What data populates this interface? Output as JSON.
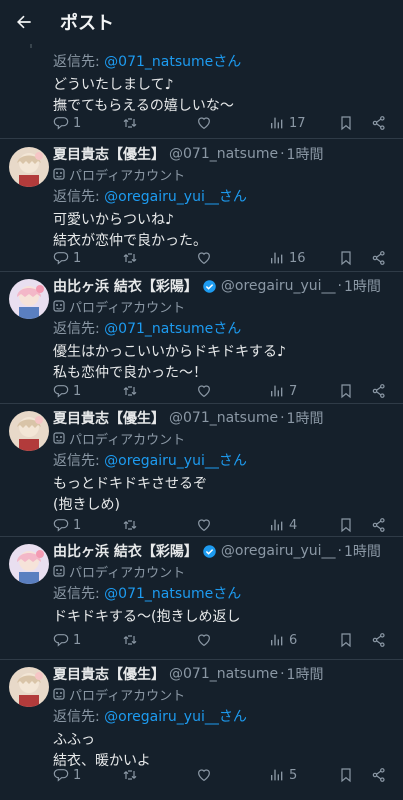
{
  "header": {
    "title": "ポスト"
  },
  "labels": {
    "reply_prefix": "返信先: ",
    "san": "さん"
  },
  "first": {
    "mention": "@071_natsume",
    "text1": "どういたしまして♪",
    "text2": "撫でてもらえるの嬉しいな〜",
    "replies": "1",
    "views": "17"
  },
  "posts": [
    {
      "name": "夏目貴志【優生】",
      "handle": "@071_natsume",
      "time": "1時間",
      "label": "パロディアカウント",
      "mention": "@oregairu_yui__",
      "text1": "可愛いからついね♪",
      "text2": "結衣が恋仲で良かった。",
      "replies": "1",
      "views": "16"
    },
    {
      "name": "由比ヶ浜 結衣【彩陽】",
      "handle": "@oregairu_yui__",
      "time": "1時間",
      "label": "パロディアカウント",
      "mention": "@071_natsume",
      "text1": "優生はかっこいいからドキドキする♪",
      "text2": "私も恋仲で良かった〜！",
      "replies": "1",
      "views": "7"
    },
    {
      "name": "夏目貴志【優生】",
      "handle": "@071_natsume",
      "time": "1時間",
      "label": "パロディアカウント",
      "mention": "@oregairu_yui__",
      "text1": "もっとドキドキさせるぞ",
      "text2": "(抱きしめ)",
      "replies": "1",
      "views": "4"
    },
    {
      "name": "由比ヶ浜 結衣【彩陽】",
      "handle": "@oregairu_yui__",
      "time": "1時間",
      "label": "パロディアカウント",
      "mention": "@071_natsume",
      "text1": "ドキドキする〜(抱きしめ返し",
      "text2": "",
      "replies": "1",
      "views": "6"
    },
    {
      "name": "夏目貴志【優生】",
      "handle": "@071_natsume",
      "time": "1時間",
      "label": "パロディアカウント",
      "mention": "@oregairu_yui__",
      "text1": "ふふっ",
      "text2": "結衣、暖かいよ",
      "replies": "1",
      "views": "5"
    }
  ],
  "colors": {
    "background": "#15202b",
    "accent": "#1d9bf0",
    "muted": "#8b98a5",
    "text": "#e7e9ea"
  },
  "icons": [
    "back-arrow-icon",
    "reply-icon",
    "retweet-icon",
    "like-icon",
    "views-icon",
    "bookmark-icon",
    "share-icon",
    "verified-badge-icon",
    "parody-mask-icon"
  ]
}
